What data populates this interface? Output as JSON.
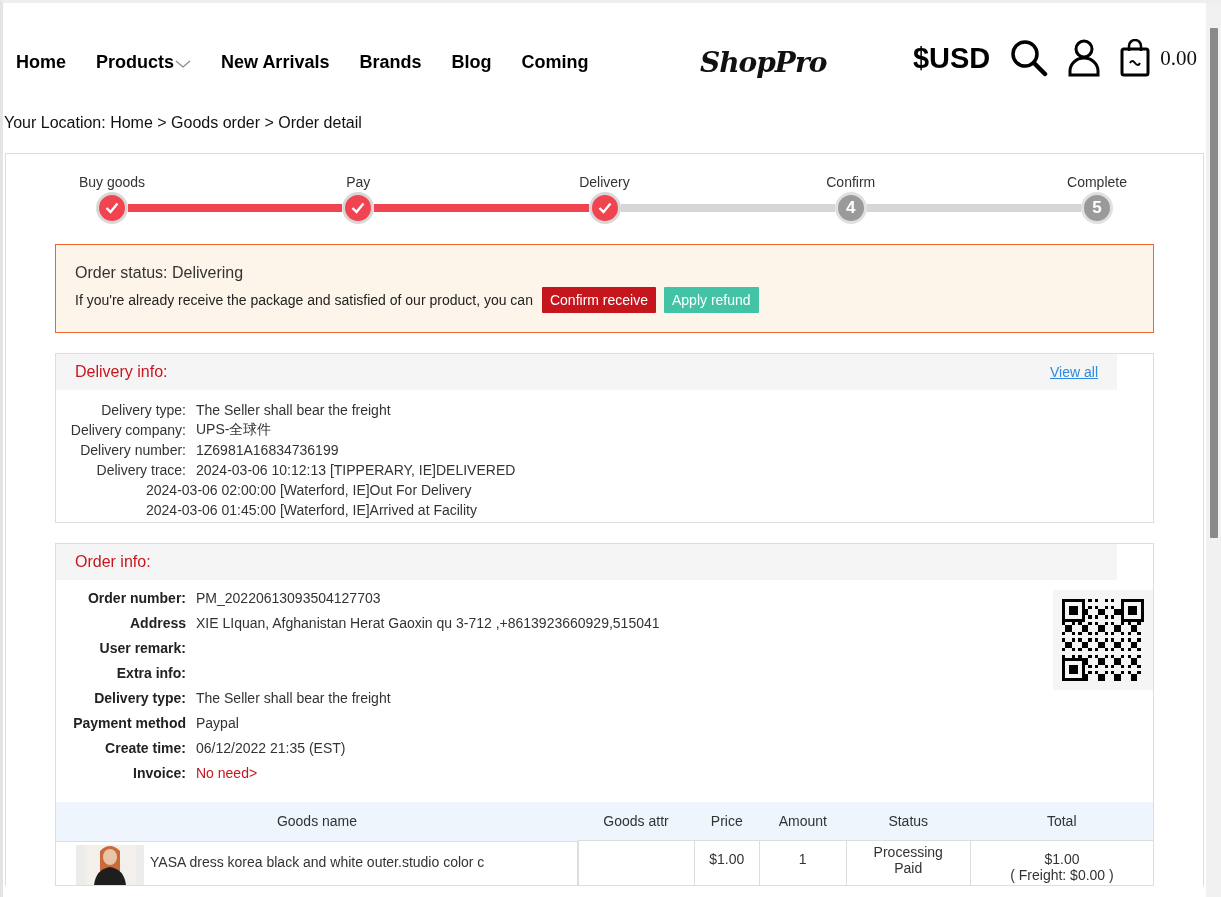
{
  "nav": {
    "items": [
      {
        "label": "Home",
        "dropdown": false
      },
      {
        "label": "Products",
        "dropdown": true
      },
      {
        "label": "New Arrivals",
        "dropdown": false
      },
      {
        "label": "Brands",
        "dropdown": false
      },
      {
        "label": "Blog",
        "dropdown": false
      },
      {
        "label": "Coming",
        "dropdown": false
      }
    ],
    "logo": "ShopPro",
    "currency": "$USD",
    "cart_total": "0.00"
  },
  "breadcrumb": "Your Location: Home > Goods order > Order detail",
  "steps": [
    {
      "label": "Buy goods",
      "done": true
    },
    {
      "label": "Pay",
      "done": true
    },
    {
      "label": "Delivery",
      "done": true
    },
    {
      "label": "Confirm",
      "number": "4",
      "done": false
    },
    {
      "label": "Complete",
      "number": "5",
      "done": false
    }
  ],
  "status": {
    "title": "Order status: Delivering",
    "message": "If you're already receive the package and satisfied of our product, you can",
    "buttons": [
      {
        "label": "Confirm receive",
        "kind": "primary"
      },
      {
        "label": "Apply refund",
        "kind": "secondary"
      }
    ]
  },
  "delivery_info": {
    "title": "Delivery info:",
    "link": "View all",
    "fields": [
      {
        "label": "Delivery type:",
        "value": "The Seller shall bear the freight"
      },
      {
        "label": "Delivery company:",
        "value": "UPS-全球件"
      },
      {
        "label": "Delivery number:",
        "value": "1Z6981A16834736199"
      },
      {
        "label": "Delivery trace:",
        "value": "2024-03-06 10:12:13 [TIPPERARY, IE]DELIVERED"
      }
    ],
    "trace_more": [
      "2024-03-06 02:00:00 [Waterford, IE]Out For Delivery",
      "2024-03-06 01:45:00 [Waterford, IE]Arrived at Facility"
    ]
  },
  "order_info": {
    "title": "Order info:",
    "fields": [
      {
        "label": "Order number:",
        "value": "PM_20220613093504127703",
        "kind": "plain"
      },
      {
        "label": "Address",
        "value": "XIE LIquan, Afghanistan Herat Gaoxin qu 3-712 ,+8613923660929,515041",
        "kind": "plain"
      },
      {
        "label": "User remark:"
      },
      {
        "label": "Extra info:"
      },
      {
        "label": "Delivery type:",
        "value": "The Seller shall bear the freight",
        "kind": "plain"
      },
      {
        "label": "Payment method",
        "value": "Paypal",
        "kind": "plain"
      },
      {
        "label": "Create time:",
        "value": "06/12/2022 21:35 (EST)",
        "kind": "plain"
      },
      {
        "label": "Invoice:",
        "value": "No need>",
        "kind": "link"
      }
    ]
  },
  "table": {
    "columns": [
      "Goods name",
      "Goods attr",
      "Price",
      "Amount",
      "Status",
      "Total"
    ],
    "rows": [
      {
        "name": "YASA dress korea black and white outer.studio color c",
        "price": "$1.00",
        "amount": "1",
        "status": [
          "Processing",
          "Paid"
        ],
        "total": "$1.00",
        "freight": "( Freight: $0.00 )"
      }
    ]
  }
}
